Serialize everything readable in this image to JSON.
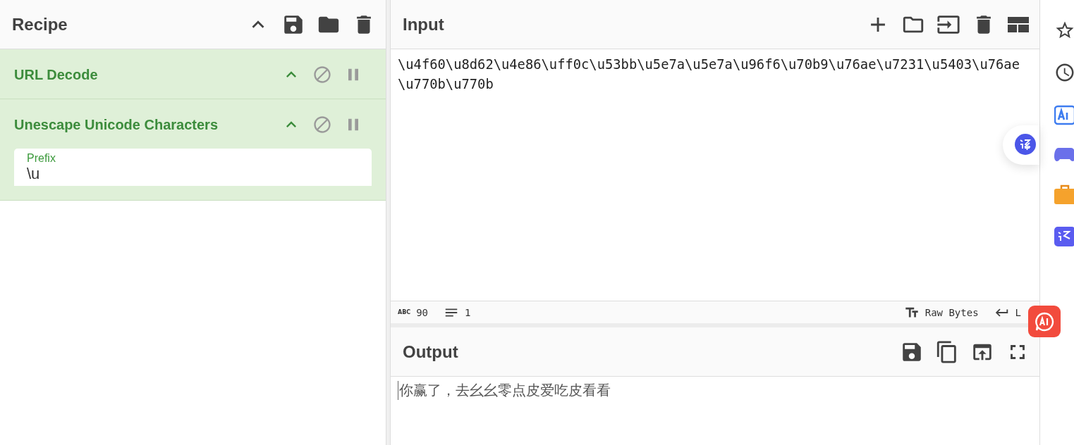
{
  "recipe": {
    "title": "Recipe",
    "operations": [
      {
        "name": "URL Decode"
      },
      {
        "name": "Unescape Unicode Characters",
        "args": [
          {
            "label": "Prefix",
            "value": "\\u"
          }
        ]
      }
    ]
  },
  "input": {
    "title": "Input",
    "text": "\\u4f60\\u8d62\\u4e86\\uff0c\\u53bb\\u5e7a\\u5e7a\\u96f6\\u70b9\\u76ae\\u7231\\u5403\\u76ae\\u770b\\u770b",
    "status": {
      "length_icon": "ABC",
      "length": "90",
      "lines": "1",
      "encoding": "Raw Bytes",
      "eol": "L"
    }
  },
  "output": {
    "title": "Output",
    "text": "你赢了，去幺幺零点皮爱吃皮看看"
  }
}
